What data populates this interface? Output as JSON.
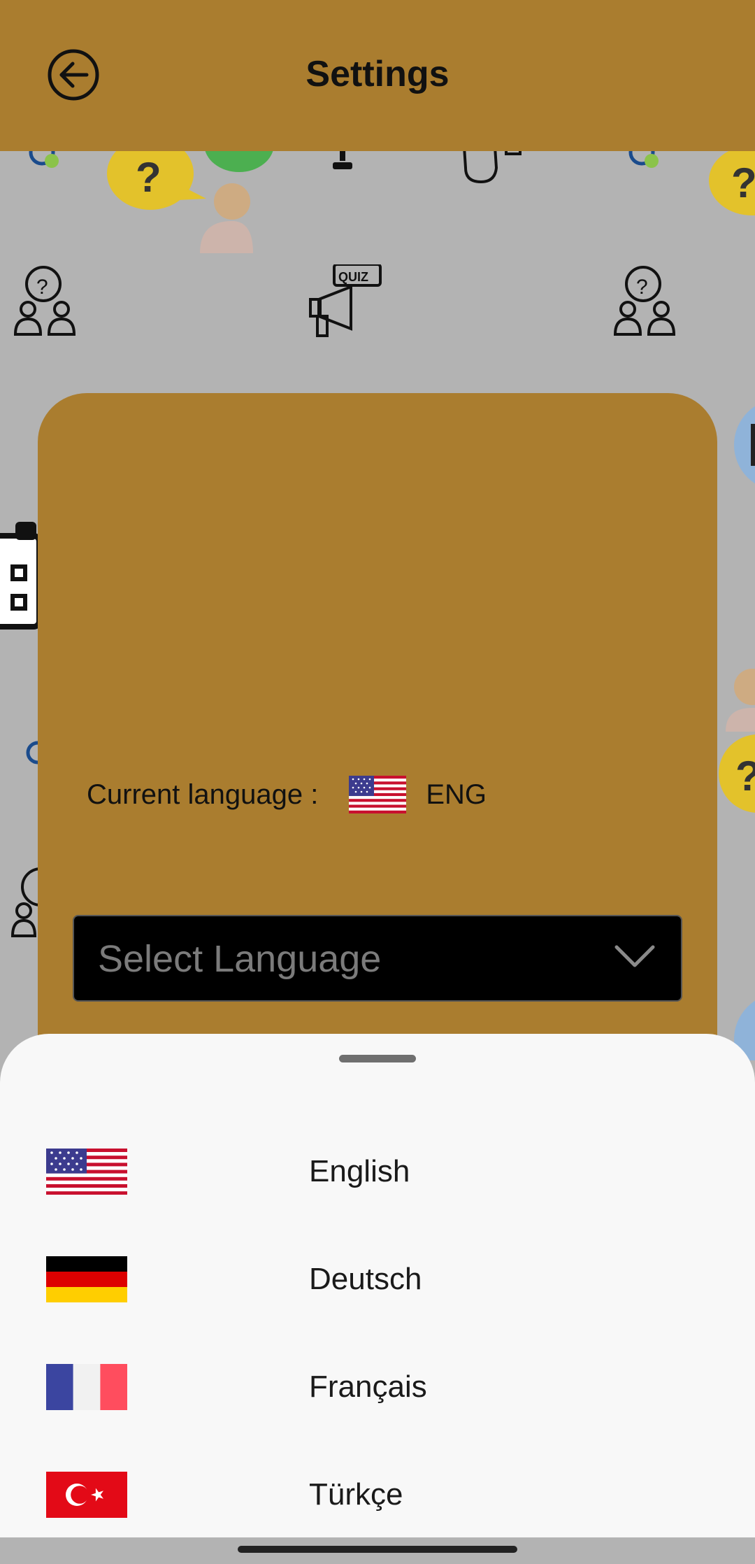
{
  "app_bar": {
    "title": "Settings",
    "back_icon": "arrow-left-circle-icon"
  },
  "background": {
    "quiz_badge_text": "QUIZ",
    "question_mark": "?"
  },
  "card": {
    "current_language_label": "Current language :",
    "current_language_code": "ENG",
    "current_language_flag": "us-flag-icon",
    "select": {
      "placeholder": "Select Language",
      "chevron_icon": "chevron-down-icon"
    }
  },
  "language_sheet": {
    "items": [
      {
        "label": "English",
        "flag": "us-flag-icon"
      },
      {
        "label": "Deutsch",
        "flag": "germany-flag-icon"
      },
      {
        "label": "Français",
        "flag": "france-flag-icon"
      },
      {
        "label": "Türkçe",
        "flag": "turkey-flag-icon"
      }
    ]
  },
  "colors": {
    "accent": "#aa7d2f",
    "background": "#b3b3b3",
    "sheet": "#f8f8f8",
    "select_bg": "#000000"
  }
}
